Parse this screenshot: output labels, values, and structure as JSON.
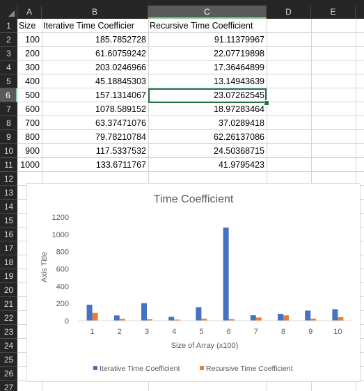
{
  "columns": [
    "A",
    "B",
    "C",
    "D",
    "E"
  ],
  "rows": [
    "1",
    "2",
    "3",
    "4",
    "5",
    "6",
    "7",
    "8",
    "9",
    "10",
    "11",
    "12",
    "13",
    "14",
    "15",
    "16",
    "17",
    "18",
    "19",
    "20",
    "21",
    "22",
    "23",
    "24",
    "25",
    "26",
    "27"
  ],
  "header_row": [
    "Size",
    "Iterative Time Coefficier",
    "Recursive Time Coefficient"
  ],
  "data_rows": [
    [
      "100",
      "185.7852728",
      "91.11379967"
    ],
    [
      "200",
      "61.60759242",
      "22.07719898"
    ],
    [
      "300",
      "203.0246966",
      "17.36464899"
    ],
    [
      "400",
      "45.18845303",
      "13.14943639"
    ],
    [
      "500",
      "157.1314067",
      "23.07262545"
    ],
    [
      "600",
      "1078.589152",
      "18.97283464"
    ],
    [
      "700",
      "63.37471076",
      "37.0289418"
    ],
    [
      "800",
      "79.78210784",
      "62.26137086"
    ],
    [
      "900",
      "117.5337532",
      "24.50368715"
    ],
    [
      "1000",
      "133.6711767",
      "41.9795423"
    ]
  ],
  "selection": {
    "column": "C",
    "row": "6"
  },
  "colors": {
    "iterative": "#4472c4",
    "recursive": "#ed7d31",
    "selection": "#217346",
    "header_bg": "#262626"
  },
  "chart_data": {
    "type": "bar",
    "title": "Time Coefficient",
    "xlabel": "Size of Array (x100)",
    "ylabel": "Axis Title",
    "categories": [
      "1",
      "2",
      "3",
      "4",
      "5",
      "6",
      "7",
      "8",
      "9",
      "10"
    ],
    "series": [
      {
        "name": "Iterative Time Coefficient",
        "values": [
          185.7852728,
          61.60759242,
          203.0246966,
          45.18845303,
          157.1314067,
          1078.589152,
          63.37471076,
          79.78210784,
          117.5337532,
          133.6711767
        ]
      },
      {
        "name": "Recursive Time Coefficient",
        "values": [
          91.11379967,
          22.07719898,
          17.36464899,
          13.14943639,
          23.07262545,
          18.97283464,
          37.0289418,
          62.26137086,
          24.50368715,
          41.9795423
        ]
      }
    ],
    "yticks": [
      "0",
      "200",
      "400",
      "600",
      "800",
      "1000",
      "1200"
    ],
    "ylim": [
      0,
      1200
    ],
    "grid": false,
    "legend": "bottom"
  }
}
